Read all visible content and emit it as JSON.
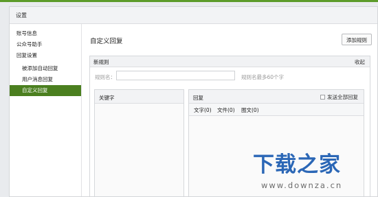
{
  "panel": {
    "title": "设置"
  },
  "sidebar": {
    "items": [
      {
        "label": "账号信息"
      },
      {
        "label": "公众号助手"
      },
      {
        "label": "回复设置"
      },
      {
        "label": "被添加自动回复"
      },
      {
        "label": "用户消息回复"
      },
      {
        "label": "自定义回复"
      }
    ]
  },
  "main": {
    "title": "自定义回复",
    "add_rule_label": "添加规则",
    "rule": {
      "title": "新规则",
      "collapse_label": "收起",
      "name_label": "规则名：",
      "name_value": "",
      "name_hint": "规则名最多60个字"
    },
    "keywords": {
      "title": "关键字"
    },
    "reply": {
      "title": "回复",
      "send_all_label": "发送全部回复",
      "tabs": [
        {
          "label": "文字(0)"
        },
        {
          "label": "文件(0)"
        },
        {
          "label": "图文(0)"
        }
      ]
    }
  },
  "watermark": {
    "cn": "下载之家",
    "en": "www.downza.cn"
  },
  "colors": {
    "accent": "#4b7f1f",
    "watermark_blue": "#2b67b6"
  }
}
